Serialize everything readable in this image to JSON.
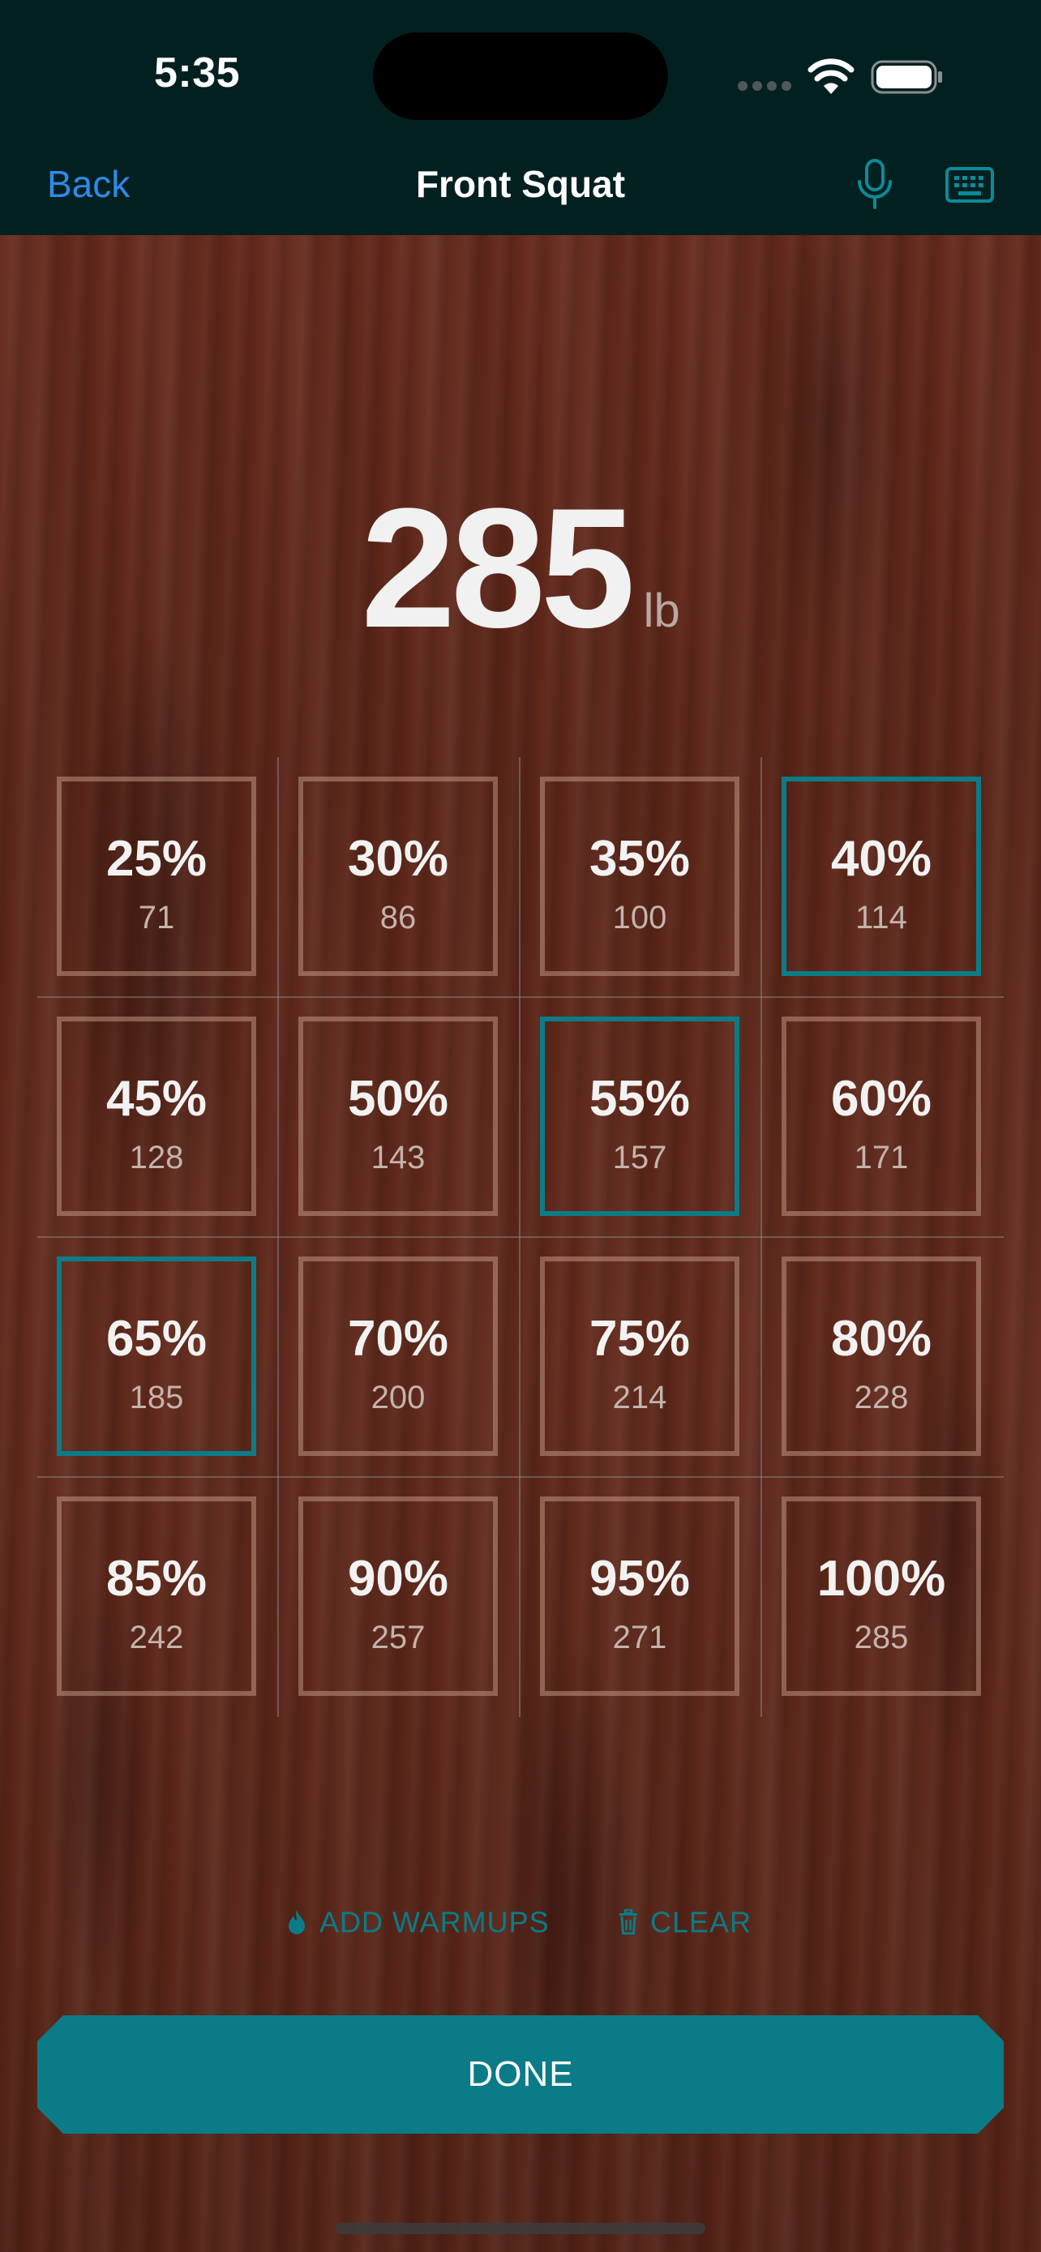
{
  "status_bar": {
    "time": "5:35"
  },
  "nav": {
    "back_label": "Back",
    "title": "Front Squat",
    "icons": [
      "microphone-icon",
      "keyboard-icon"
    ]
  },
  "weight": {
    "value": "285",
    "unit": "lb"
  },
  "percentages": [
    {
      "pct": "25%",
      "weight": "71",
      "selected": false
    },
    {
      "pct": "30%",
      "weight": "86",
      "selected": false
    },
    {
      "pct": "35%",
      "weight": "100",
      "selected": false
    },
    {
      "pct": "40%",
      "weight": "114",
      "selected": true
    },
    {
      "pct": "45%",
      "weight": "128",
      "selected": false
    },
    {
      "pct": "50%",
      "weight": "143",
      "selected": false
    },
    {
      "pct": "55%",
      "weight": "157",
      "selected": true
    },
    {
      "pct": "60%",
      "weight": "171",
      "selected": false
    },
    {
      "pct": "65%",
      "weight": "185",
      "selected": true
    },
    {
      "pct": "70%",
      "weight": "200",
      "selected": false
    },
    {
      "pct": "75%",
      "weight": "214",
      "selected": false
    },
    {
      "pct": "80%",
      "weight": "228",
      "selected": false
    },
    {
      "pct": "85%",
      "weight": "242",
      "selected": false
    },
    {
      "pct": "90%",
      "weight": "257",
      "selected": false
    },
    {
      "pct": "95%",
      "weight": "271",
      "selected": false
    },
    {
      "pct": "100%",
      "weight": "285",
      "selected": false
    }
  ],
  "actions": {
    "add_warmups_label": "ADD WARMUPS",
    "clear_label": "CLEAR",
    "done_label": "DONE"
  },
  "colors": {
    "accent": "#0b7c87",
    "link": "#2f8ae6",
    "nav_background": "#032021"
  }
}
